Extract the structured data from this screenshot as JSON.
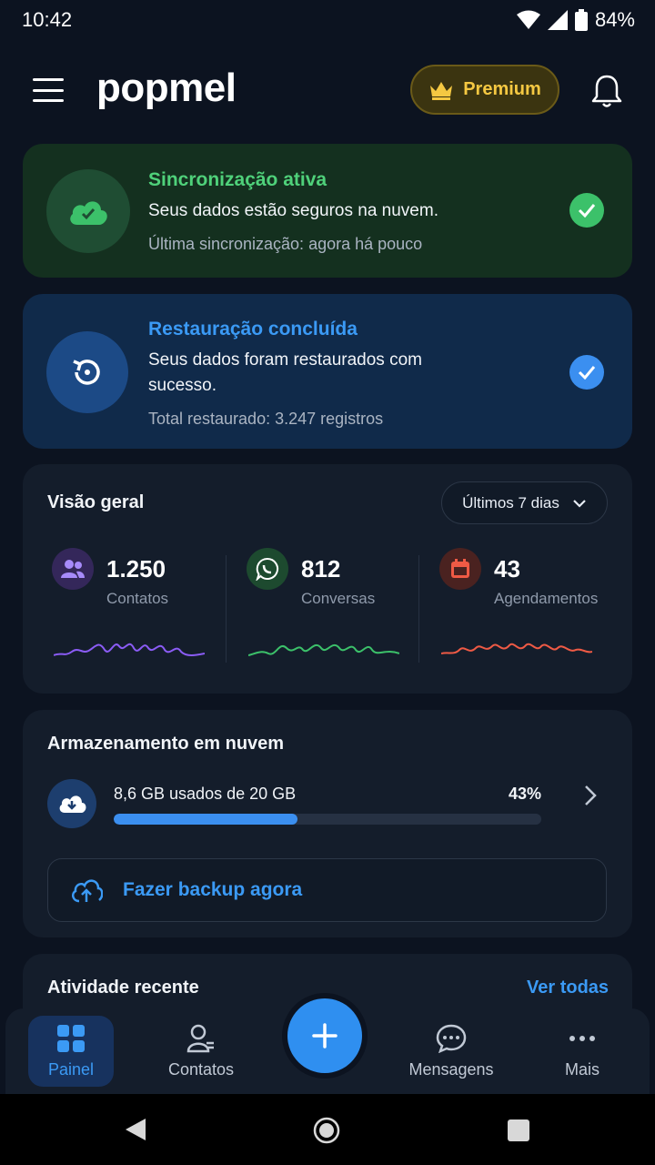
{
  "status": {
    "time": "10:42",
    "battery": "84%"
  },
  "header": {
    "logo": "popmel",
    "premium_label": "Premium"
  },
  "sync_card": {
    "title": "Sincronização ativa",
    "text": "Seus dados estão seguros na nuvem.",
    "sub": "Última sincronização: agora há pouco"
  },
  "restore_card": {
    "title": "Restauração concluída",
    "text": "Seus dados foram restaurados com sucesso.",
    "sub": "Total restaurado: 3.247 registros"
  },
  "overview": {
    "title": "Visão geral",
    "period": "Últimos 7 dias",
    "metrics": [
      {
        "value": "1.250",
        "label": "Contatos",
        "color": "#8b5cf6"
      },
      {
        "value": "812",
        "label": "Conversas",
        "color": "#3cc16a"
      },
      {
        "value": "43",
        "label": "Agendamentos",
        "color": "#ef5a45"
      }
    ]
  },
  "storage": {
    "title": "Armazenamento em nuvem",
    "usage_text": "8,6 GB usados de 20 GB",
    "percent_label": "43%",
    "percent": 43,
    "backup_label": "Fazer backup agora"
  },
  "activity": {
    "title": "Atividade recente",
    "see_all": "Ver todas"
  },
  "nav": {
    "items": [
      {
        "label": "Painel"
      },
      {
        "label": "Contatos"
      },
      {
        "label": "Mensagens"
      },
      {
        "label": "Mais"
      }
    ]
  },
  "colors": {
    "accent": "#3b8ff0",
    "success": "#3cc16a",
    "premium": "#f5c842"
  }
}
